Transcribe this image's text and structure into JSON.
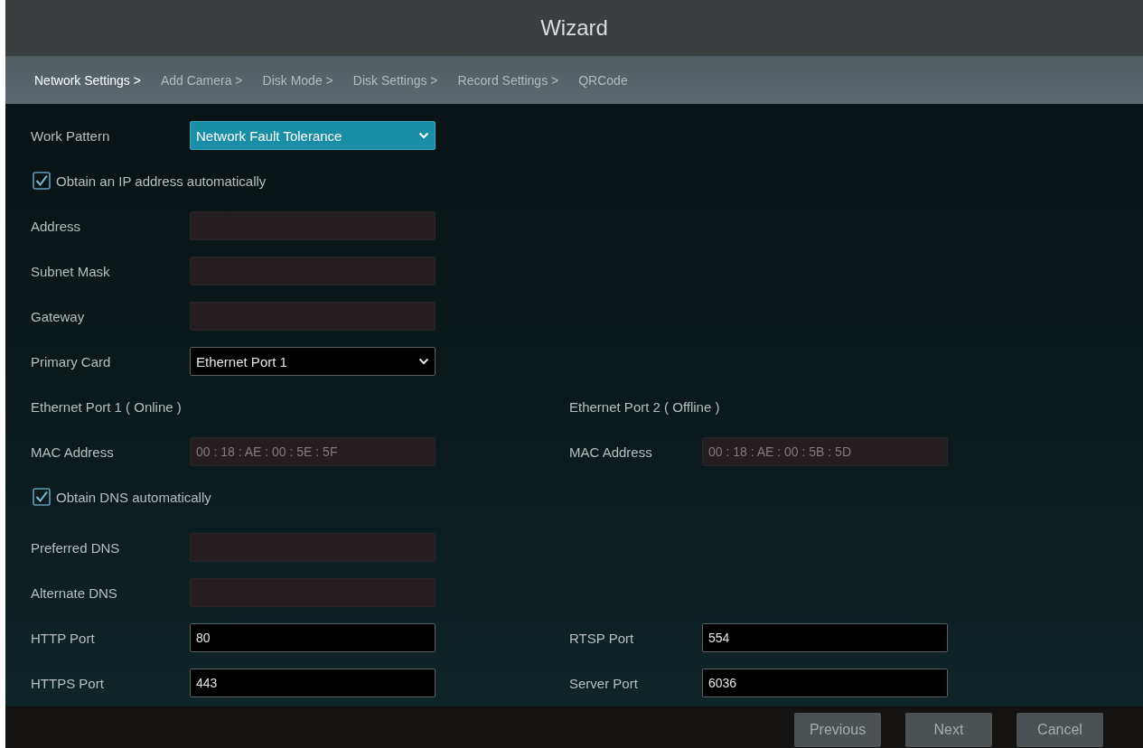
{
  "window": {
    "title": "Wizard"
  },
  "steps": [
    {
      "label": "Network Settings >",
      "selected": true
    },
    {
      "label": "Add Camera >",
      "selected": false
    },
    {
      "label": "Disk Mode >",
      "selected": false
    },
    {
      "label": "Disk Settings >",
      "selected": false
    },
    {
      "label": "Record Settings >",
      "selected": false
    },
    {
      "label": "QRCode",
      "selected": false
    }
  ],
  "form": {
    "rows": [
      {
        "kind": "select",
        "label": "Work Pattern",
        "value": "Network Fault Tolerance",
        "focused": true
      },
      {
        "kind": "checkbox",
        "label": "Obtain an IP address automatically",
        "checked": true
      },
      {
        "kind": "field",
        "label": "Address",
        "disabled": true
      },
      {
        "kind": "field",
        "label": "Subnet Mask",
        "disabled": true
      },
      {
        "kind": "field",
        "label": "Gateway",
        "disabled": true
      },
      {
        "kind": "select",
        "label": "Primary Card",
        "value": "Ethernet Port 1",
        "focused": false
      },
      {
        "kind": "headings",
        "items": [
          "Ethernet Port 1 ( Online )",
          "Ethernet Port 2 ( Offline )"
        ]
      },
      {
        "kind": "field-pair",
        "fields": [
          {
            "label": "MAC Address",
            "value": "00 : 18 : AE : 00 : 5E : 5F",
            "disabled": true
          },
          {
            "label": "MAC Address",
            "value": "00 : 18 : AE : 00 : 5B : 5D",
            "disabled": true
          }
        ]
      },
      {
        "kind": "checkbox",
        "label": "Obtain DNS automatically",
        "checked": true
      },
      {
        "kind": "field",
        "label": "Preferred DNS",
        "disabled": true
      },
      {
        "kind": "field",
        "label": "Alternate DNS",
        "disabled": true
      },
      {
        "kind": "field-pair",
        "fields": [
          {
            "label": "HTTP Port",
            "value": "80",
            "disabled": false
          },
          {
            "label": "RTSP Port",
            "value": "554",
            "disabled": false
          }
        ]
      },
      {
        "kind": "field-pair",
        "fields": [
          {
            "label": "HTTPS Port",
            "value": "443",
            "disabled": false
          },
          {
            "label": "Server Port",
            "value": "6036",
            "disabled": false
          }
        ]
      }
    ]
  },
  "buttons": [
    "Previous",
    "Next",
    "Cancel"
  ]
}
